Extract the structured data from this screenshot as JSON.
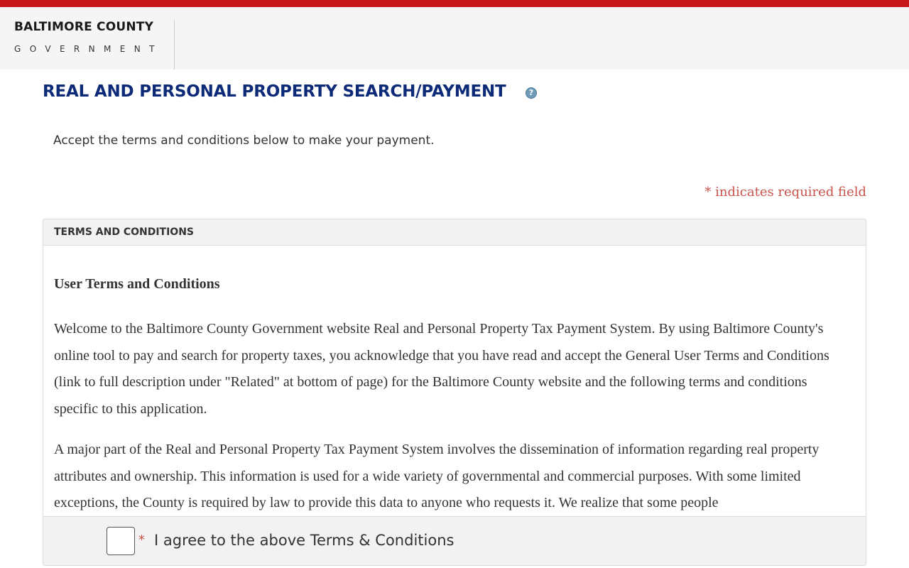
{
  "header": {
    "logo_line1": "BALTIMORE COUNTY",
    "logo_line2": "GOVERNMENT"
  },
  "page": {
    "title": "REAL AND PERSONAL PROPERTY SEARCH/PAYMENT",
    "help_icon_label": "?",
    "intro": "Accept the terms and conditions below to make your payment.",
    "required_note": "* indicates required field"
  },
  "terms_panel": {
    "title": "TERMS AND CONDITIONS",
    "heading": "User Terms and Conditions",
    "paragraphs": [
      "Welcome to the Baltimore County Government website Real and Personal Property Tax Payment System. By using Baltimore County's online tool to pay and search for property taxes, you acknowledge that you have read and accept the General User Terms and Conditions (link to full description under \"Related\" at bottom of page) for the Baltimore County website and the following terms and conditions specific to this application.",
      "A major part of the Real and Personal Property Tax Payment System involves the dissemination of information regarding real property attributes and ownership. This information is used for a wide variety of governmental and commercial purposes. With some limited exceptions, the County is required by law to provide this data to anyone who requests it. We realize that some people"
    ]
  },
  "agreement": {
    "required_marker": "*",
    "label": "I agree to the above Terms & Conditions",
    "checked": false
  },
  "colors": {
    "top_bar": "#c8161d",
    "title": "#0d2a78",
    "required": "#c9524a"
  }
}
